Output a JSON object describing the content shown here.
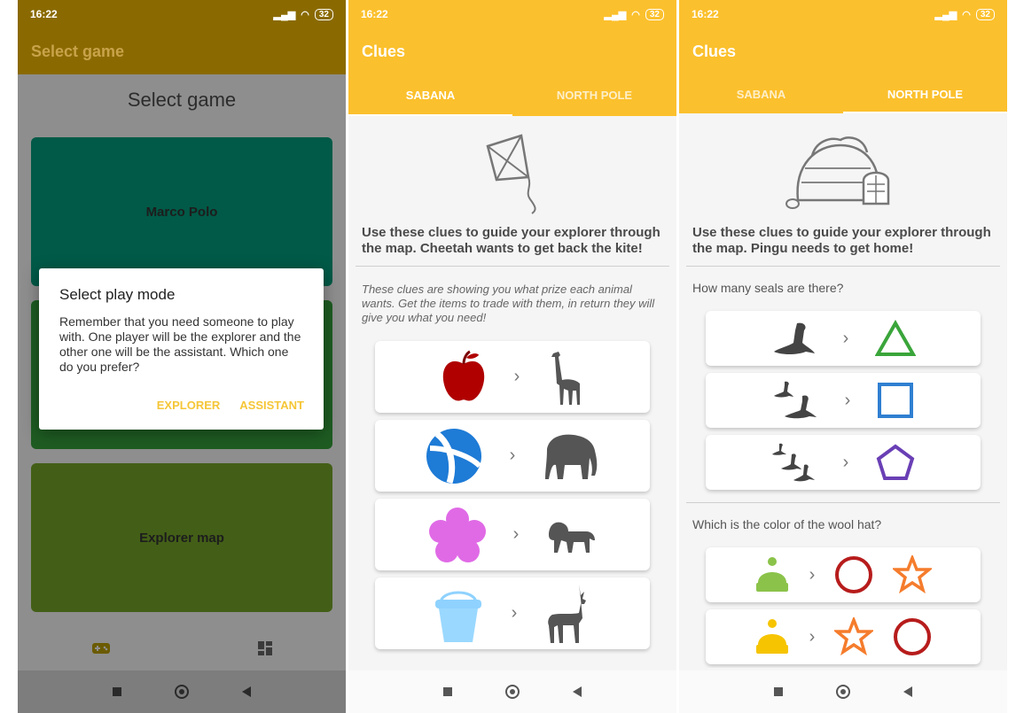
{
  "screen1": {
    "status": {
      "time": "16:22",
      "battery": "32"
    },
    "appbar_title": "Select game",
    "page_title": "Select game",
    "cards": [
      {
        "label": "Marco Polo",
        "color": "#005a47"
      },
      {
        "label": "",
        "color": "#1e5c22"
      },
      {
        "label": "Explorer map",
        "color": "#435f17"
      }
    ],
    "dialog": {
      "title": "Select play mode",
      "message": "Remember that you need someone to play with. One player will be the explorer and the other one will be the assistant. Which one do you prefer?",
      "explorer_label": "EXPLORER",
      "assistant_label": "ASSISTANT"
    },
    "bottom_nav": {
      "games_icon": "gamepad-icon",
      "dashboard_icon": "dashboard-icon"
    }
  },
  "screen2": {
    "status": {
      "time": "16:22",
      "battery": "32"
    },
    "appbar_title": "Clues",
    "tabs": [
      {
        "label": "SABANA",
        "active": true
      },
      {
        "label": "NORTH POLE",
        "active": false
      }
    ],
    "hero_icon": "kite-icon",
    "intro": "Use these clues to guide your explorer through the map. Cheetah wants to get back the kite!",
    "note": "These clues are showing you what prize each animal wants. Get the items to trade with them, in return they will give you what you need!",
    "clues": [
      {
        "item": "apple-icon",
        "animal": "giraffe-icon"
      },
      {
        "item": "beach-ball-icon",
        "animal": "elephant-icon"
      },
      {
        "item": "flower-icon",
        "animal": "lion-icon"
      },
      {
        "item": "bucket-icon",
        "animal": "gazelle-icon"
      }
    ]
  },
  "screen3": {
    "status": {
      "time": "16:22",
      "battery": "32"
    },
    "appbar_title": "Clues",
    "tabs": [
      {
        "label": "SABANA",
        "active": false
      },
      {
        "label": "NORTH POLE",
        "active": true
      }
    ],
    "hero_icon": "igloo-icon",
    "intro": "Use these clues to guide your explorer through the map. Pingu needs to get home!",
    "question1": "How many seals are there?",
    "seal_clues": [
      {
        "count": 1,
        "shape": "triangle-icon",
        "color": "#3aa53a"
      },
      {
        "count": 2,
        "shape": "square-icon",
        "color": "#2f7fd1"
      },
      {
        "count": 3,
        "shape": "pentagon-icon",
        "color": "#6a3fb5"
      }
    ],
    "question2": "Which is the color of the wool hat?",
    "hat_clues": [
      {
        "hat_color": "#8bc34a",
        "shapes": [
          "circle-icon",
          "star-icon"
        ]
      },
      {
        "hat_color": "#f6c400",
        "shapes": [
          "star-icon",
          "circle-icon"
        ]
      }
    ],
    "accent": {
      "red": "#b71c1c",
      "orange": "#f57c2c"
    }
  }
}
